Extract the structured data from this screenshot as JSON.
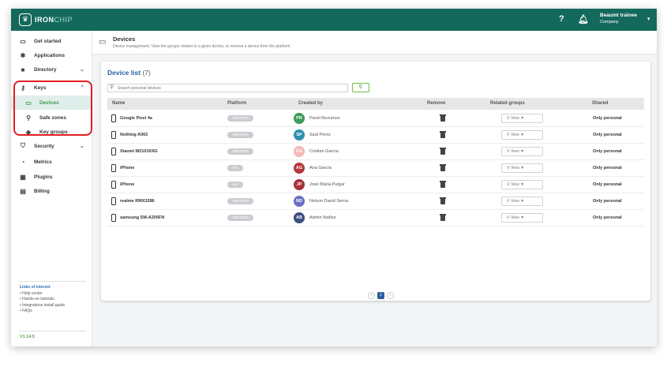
{
  "topbar": {
    "logo_text": "IRON",
    "logo_text2": "CHIP",
    "help_icon": "?",
    "user_name": "Beaumt trainee",
    "user_role": "Company"
  },
  "sidebar": {
    "items": [
      {
        "label": "Get started",
        "icon": "monitor-icon"
      },
      {
        "label": "Applications",
        "icon": "puzzle-icon"
      },
      {
        "label": "Directory",
        "icon": "folder-icon"
      },
      {
        "label": "Keys",
        "icon": "key-icon"
      },
      {
        "label": "Devices",
        "icon": "device-icon"
      },
      {
        "label": "Safe zones",
        "icon": "location-pin-icon"
      },
      {
        "label": "Key groups",
        "icon": "tag-icon"
      },
      {
        "label": "Security",
        "icon": "shield-icon"
      },
      {
        "label": "Metrics",
        "icon": "metrics-icon"
      },
      {
        "label": "Plugins",
        "icon": "plugins-icon"
      },
      {
        "label": "Billing",
        "icon": "billing-icon"
      }
    ],
    "links_title": "Links of interest",
    "links": [
      "• Help center",
      "• Hands-on tutorials",
      "• Integrations install guide",
      "• FAQs"
    ],
    "version": "V1.14.5"
  },
  "page": {
    "title": "Devices",
    "description": "Device management. View the groups related to a given device, or remove a device from the platform."
  },
  "card": {
    "title": "Device list",
    "count": "(7)",
    "search_placeholder": "Search personal devices",
    "columns": [
      "Name",
      "Platform",
      "Created by",
      "Remove",
      "Related groups",
      "Shared"
    ]
  },
  "devices": [
    {
      "name": "Google Pixel 4a",
      "platform": "ANDROID",
      "initials": "PR",
      "avatar_color": "#3e9b5a",
      "creator": "Pavel Rezumov",
      "view": "View ▼",
      "shared": "Only personal"
    },
    {
      "name": "Nothing A063",
      "platform": "ANDROID",
      "initials": "SP",
      "avatar_color": "#2f8fae",
      "creator": "Saúl Pérez",
      "view": "View ▼",
      "shared": "Only personal"
    },
    {
      "name": "Xiaomi M2101K6G",
      "platform": "ANDROID",
      "initials": "CG",
      "avatar_color": "#f2b8b8",
      "creator": "Cristian García",
      "view": "View ▼",
      "shared": "Only personal"
    },
    {
      "name": "iPhone",
      "platform": "IOS",
      "initials": "AG",
      "avatar_color": "#b3373f",
      "creator": "Ana García",
      "view": "View ▼",
      "shared": "Only personal"
    },
    {
      "name": "iPhone",
      "platform": "IOS",
      "initials": "JP",
      "avatar_color": "#a8323a",
      "creator": "José María Pulgar",
      "view": "View ▼",
      "shared": "Only personal"
    },
    {
      "name": "realme RMX3286",
      "platform": "ANDROID",
      "initials": "ND",
      "avatar_color": "#6a6fc4",
      "creator": "Nelson David Serna",
      "view": "View ▼",
      "shared": "Only personal"
    },
    {
      "name": "samsung SM-A205FN",
      "platform": "ANDROID",
      "initials": "AB",
      "avatar_color": "#3d4f7c",
      "creator": "Admin Ibañez",
      "view": "View ▼",
      "shared": "Only personal"
    }
  ],
  "pager": {
    "prev": "‹",
    "current": "1",
    "next": "›"
  }
}
